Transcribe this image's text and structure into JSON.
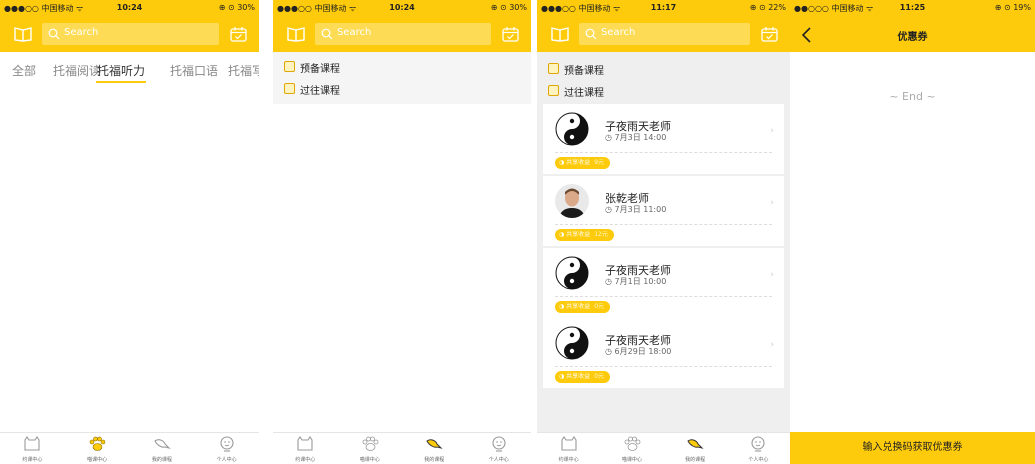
{
  "screens": [
    {
      "status": {
        "carrier": "●●●○○ 中国移动 ᯤ",
        "time": "10:24",
        "battery": "⊕ ⊙ 30%"
      },
      "search_placeholder": "Search",
      "categories": [
        "全部",
        "托福阅读",
        "托福听力",
        "托福口语",
        "托福写作"
      ],
      "active_category": "托福听力",
      "tabs": [
        "约课中心",
        "喵课中心",
        "我的课程",
        "个人中心"
      ]
    },
    {
      "status": {
        "carrier": "●●●○○ 中国移动 ᯤ",
        "time": "10:24",
        "battery": "⊕ ⊙ 30%"
      },
      "search_placeholder": "Search",
      "menu": [
        "预备课程",
        "过往课程"
      ],
      "tabs": [
        "约课中心",
        "喵课中心",
        "我的课程",
        "个人中心"
      ]
    },
    {
      "status": {
        "carrier": "●●●○○ 中国移动 ᯤ",
        "time": "11:17",
        "battery": "⊕ ⊙ 22%"
      },
      "search_placeholder": "Search",
      "menu": [
        "预备课程",
        "过往课程"
      ],
      "courses": [
        {
          "teacher": "子夜雨天老师",
          "time": "7月3日 14:00",
          "badge_label": "共享收益",
          "badge_value": "9元",
          "avatar": "yin-yang-icon"
        },
        {
          "teacher": "张乾老师",
          "time": "7月3日 11:00",
          "badge_label": "共享收益",
          "badge_value": "12元",
          "avatar": "person-photo"
        },
        {
          "teacher": "子夜雨天老师",
          "time": "7月1日 10:00",
          "badge_label": "共享收益",
          "badge_value": "0元",
          "avatar": "yin-yang-icon"
        },
        {
          "teacher": "子夜雨天老师",
          "time": "6月29日 18:00",
          "badge_label": "共享收益",
          "badge_value": "0元",
          "avatar": "yin-yang-icon"
        }
      ],
      "tabs": [
        "约课中心",
        "喵课中心",
        "我的课程",
        "个人中心"
      ]
    },
    {
      "status": {
        "carrier": "●●○○○ 中国移动 ᯤ",
        "time": "11:25",
        "battery": "⊕ ⊙ 19%"
      },
      "title": "优惠券",
      "end_text": "~ End ~",
      "button": "输入兑换码获取优惠券"
    }
  ],
  "colors": {
    "accent": "#fdcb0b",
    "background": "#efefef"
  }
}
